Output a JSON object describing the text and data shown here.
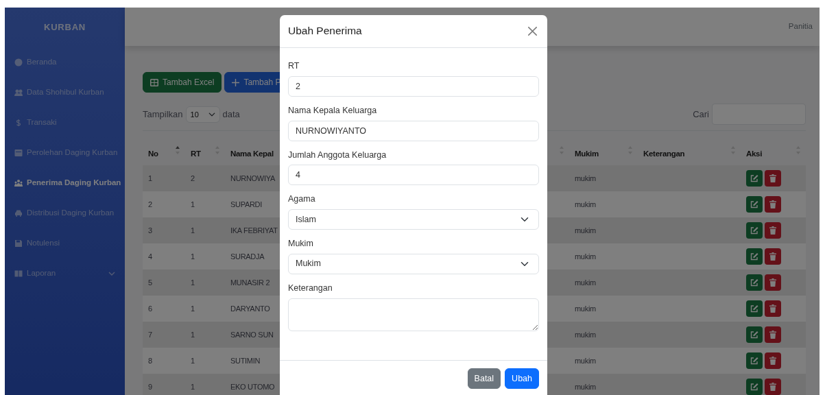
{
  "sidebar": {
    "brand": "KURBAN",
    "items": [
      {
        "label": "Beranda",
        "selected": false,
        "kind": "link"
      },
      {
        "label": "Data Shohibul Kurban",
        "selected": false,
        "kind": "link"
      },
      {
        "label": "Transaki",
        "selected": false,
        "kind": "link"
      },
      {
        "label": "Perolehan Daging Kurban",
        "selected": false,
        "kind": "link"
      },
      {
        "label": "Penerima Daging Kurban",
        "selected": true,
        "kind": "link"
      },
      {
        "label": "Distribusi Daging Kurban",
        "selected": false,
        "kind": "link"
      },
      {
        "label": "Notulensi",
        "selected": false,
        "kind": "link"
      },
      {
        "label": "Laporan",
        "selected": false,
        "kind": "dropdown"
      }
    ]
  },
  "topbar": {
    "user": "Panitia"
  },
  "toolbar": {
    "buttons": [
      {
        "label": "Tambah Excel",
        "kind": "excel"
      },
      {
        "label": "Tambah P",
        "kind": "add"
      }
    ]
  },
  "length_control": {
    "label": "Tampilkan",
    "value": "10",
    "suffix": "data"
  },
  "search": {
    "label": "Cari"
  },
  "table": {
    "columns": [
      {
        "label": "No",
        "sorted_ascending": true
      },
      {
        "label": "RT",
        "sorted_ascending": false
      },
      {
        "label": "Nama Kepal",
        "sorted_ascending": false
      },
      {
        "label": "Mukim",
        "sorted_ascending": false
      },
      {
        "label": "Keterangan",
        "sorted_ascending": false
      },
      {
        "label": "Aksi",
        "sorted_ascending": false
      }
    ],
    "rows": [
      {
        "no": "1",
        "rt": "2",
        "name": "NURNOWIYA",
        "mukim": "mukim"
      },
      {
        "no": "2",
        "rt": "1",
        "name": "SUPARDI",
        "mukim": "mukim"
      },
      {
        "no": "3",
        "rt": "1",
        "name": "IKA FEBRIYAT",
        "mukim": "mukim"
      },
      {
        "no": "4",
        "rt": "1",
        "name": "SURADJA",
        "mukim": "mukim"
      },
      {
        "no": "5",
        "rt": "1",
        "name": "MUNASIR 2",
        "mukim": "mukim"
      },
      {
        "no": "6",
        "rt": "1",
        "name": "DARYANTO",
        "mukim": "mukim"
      },
      {
        "no": "7",
        "rt": "1",
        "name": "SARNO SUN",
        "mukim": "mukim"
      },
      {
        "no": "8",
        "rt": "1",
        "name": "SUTIMIN",
        "mukim": "mukim"
      },
      {
        "no": "9",
        "rt": "1",
        "name": "EKO UTOMO",
        "mukim": "mukim"
      }
    ]
  },
  "modal": {
    "title": "Ubah Penerima",
    "fields": [
      {
        "label": "RT",
        "kind": "text",
        "value": "2"
      },
      {
        "label": "Nama Kepala Keluarga",
        "kind": "text",
        "value": "NURNOWIYANTO"
      },
      {
        "label": "Jumlah Anggota Keluarga",
        "kind": "text",
        "value": "4"
      },
      {
        "label": "Agama",
        "kind": "select",
        "value": "Islam"
      },
      {
        "label": "Mukim",
        "kind": "select",
        "value": "Mukim"
      },
      {
        "label": "Keterangan",
        "kind": "textarea"
      }
    ],
    "buttons": [
      {
        "label": "Batal",
        "kind": "secondary"
      },
      {
        "label": "Ubah",
        "kind": "primary"
      }
    ]
  }
}
